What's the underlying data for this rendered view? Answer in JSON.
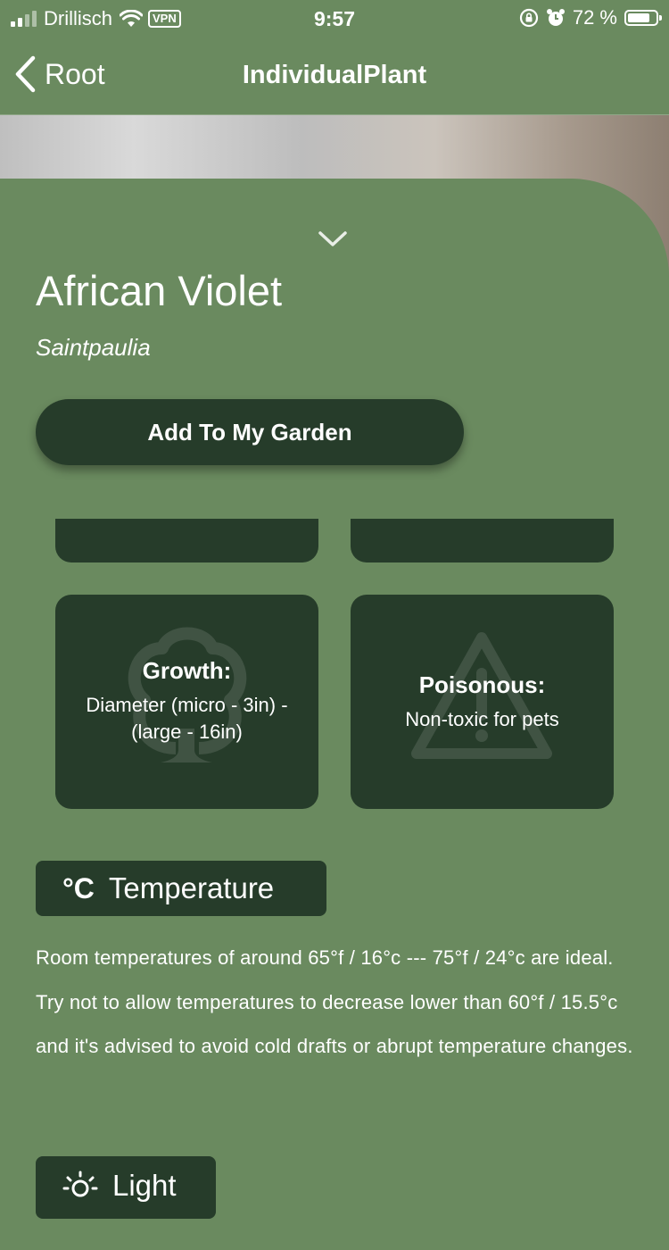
{
  "status_bar": {
    "carrier": "Drillisch",
    "vpn": "VPN",
    "time": "9:57",
    "battery": "72 %"
  },
  "nav": {
    "back_label": "Root",
    "title": "IndividualPlant"
  },
  "plant": {
    "name": "African Violet",
    "scientific_name": "Saintpaulia"
  },
  "add_button": "Add To My Garden",
  "cards": [
    {
      "icon": "tree-icon",
      "title": "Growth:",
      "text": "Diameter (micro - 3in) - (large - 16in)"
    },
    {
      "icon": "warning-icon",
      "title": "Poisonous:",
      "text": "Non-toxic for pets"
    }
  ],
  "sections": [
    {
      "icon": "celsius-icon",
      "icon_text": "°C",
      "title": "Temperature",
      "text": "Room temperatures of around 65°f / 16°c --- 75°f / 24°c are ideal. Try not to allow temperatures to decrease lower than 60°f / 15.5°c and it's advised to avoid cold drafts or abrupt temperature changes."
    },
    {
      "icon": "sun-icon",
      "title": "Light"
    }
  ],
  "colors": {
    "background": "#6a8a5f",
    "card": "#263c2a",
    "text": "#ffffff"
  }
}
